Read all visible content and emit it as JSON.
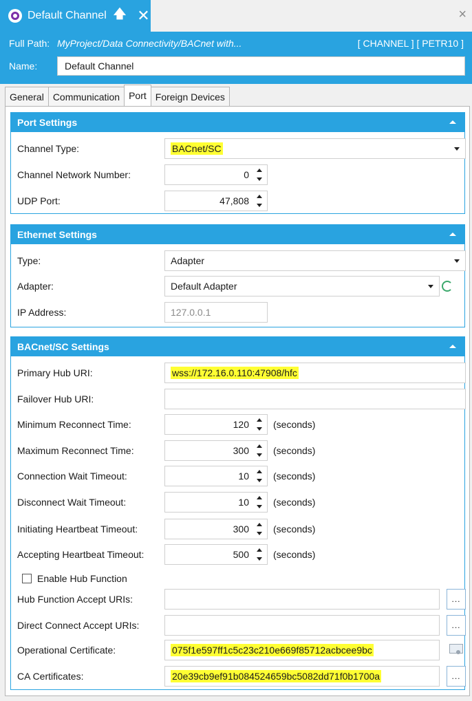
{
  "window": {
    "tab_title": "Default Channel",
    "pin_glyph": "🡅",
    "close_glyph": "✕",
    "window_close_glyph": "×"
  },
  "header": {
    "full_path_label": "Full Path:",
    "full_path_value": "MyProject/Data Connectivity/BACnet with...",
    "tags": "[ CHANNEL ] [ PETR10 ]",
    "name_label": "Name:",
    "name_value": "Default Channel"
  },
  "tabs": [
    {
      "label": "General"
    },
    {
      "label": "Communication"
    },
    {
      "label": "Port",
      "active": true
    },
    {
      "label": "Foreign Devices"
    }
  ],
  "port_settings": {
    "title": "Port Settings",
    "channel_type_label": "Channel Type:",
    "channel_type_value": "BACnet/SC",
    "network_number_label": "Channel Network Number:",
    "network_number_value": "0",
    "udp_port_label": "UDP Port:",
    "udp_port_value": "47,808"
  },
  "ethernet_settings": {
    "title": "Ethernet Settings",
    "type_label": "Type:",
    "type_value": "Adapter",
    "adapter_label": "Adapter:",
    "adapter_value": "Default Adapter",
    "ip_label": "IP Address:",
    "ip_value": "127.0.0.1"
  },
  "sc_settings": {
    "title": "BACnet/SC Settings",
    "primary_hub_label": "Primary Hub URI:",
    "primary_hub_value": "wss://172.16.0.110:47908/hfc",
    "failover_hub_label": "Failover Hub URI:",
    "failover_hub_value": "",
    "unit": "(seconds)",
    "min_reconnect_label": "Minimum Reconnect Time:",
    "min_reconnect_value": "120",
    "max_reconnect_label": "Maximum Reconnect Time:",
    "max_reconnect_value": "300",
    "conn_wait_label": "Connection Wait Timeout:",
    "conn_wait_value": "10",
    "disc_wait_label": "Disconnect Wait Timeout:",
    "disc_wait_value": "10",
    "init_hb_label": "Initiating Heartbeat Timeout:",
    "init_hb_value": "300",
    "accept_hb_label": "Accepting Heartbeat Timeout:",
    "accept_hb_value": "500",
    "enable_hub_label": "Enable Hub Function",
    "enable_hub_checked": false,
    "hub_accept_label": "Hub Function Accept URIs:",
    "hub_accept_value": "",
    "direct_accept_label": "Direct Connect Accept URIs:",
    "direct_accept_value": "",
    "op_cert_label": "Operational Certificate:",
    "op_cert_value": "075f1e597ff1c5c23c210e669f85712acbcee9bc",
    "ca_cert_label": "CA Certificates:",
    "ca_cert_value": "20e39cb9ef91b084524659bc5082dd71f0b1700a",
    "ellipsis": "..."
  },
  "colors": {
    "accent": "#29a3e0",
    "highlight": "#ffff33"
  }
}
